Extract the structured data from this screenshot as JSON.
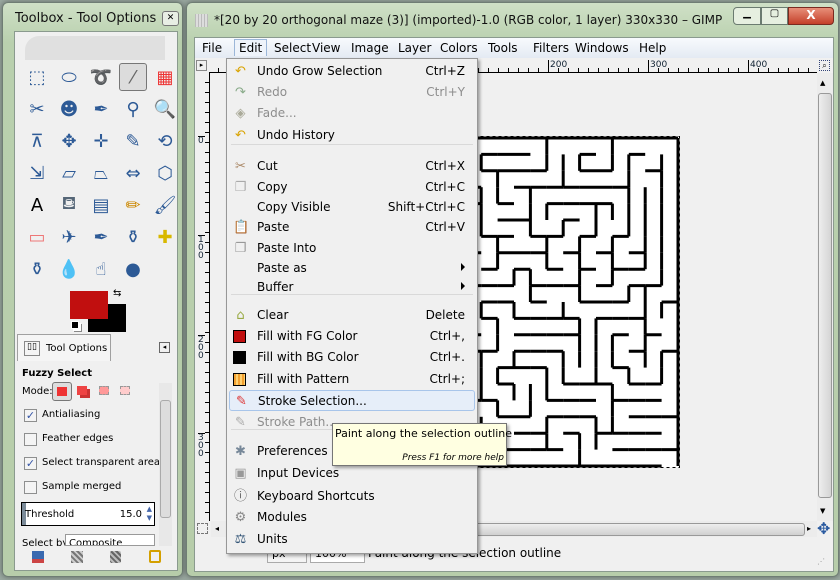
{
  "toolbox": {
    "title": "Toolbox - Tool Options",
    "tools": [
      "rect-select",
      "ellipse-select",
      "free-select",
      "fuzzy-select",
      "select-by-color",
      "scissors-select",
      "foreground-select",
      "paths",
      "color-picker",
      "zoom",
      "measure",
      "move",
      "align",
      "crop",
      "rotate",
      "scale",
      "shear",
      "perspective",
      "flip",
      "cage-transform",
      "text",
      "bucket-fill",
      "blend",
      "pencil",
      "paintbrush",
      "eraser",
      "airbrush",
      "ink",
      "clone",
      "heal",
      "perspective-clone",
      "blur-sharpen",
      "smudge",
      "dodge-burn"
    ],
    "active_tool": "fuzzy-select",
    "fg_color": "#c10f0f",
    "bg_color": "#000000"
  },
  "tool_options": {
    "tab_label": "Tool Options",
    "title": "Fuzzy Select",
    "mode_label": "Mode:",
    "options": [
      {
        "label": "Antialiasing",
        "checked": true
      },
      {
        "label": "Feather edges",
        "checked": false
      },
      {
        "label": "Select transparent areas",
        "checked": true
      },
      {
        "label": "Sample merged",
        "checked": false
      }
    ],
    "threshold_label": "Threshold",
    "threshold_value": "15.0",
    "select_by_label": "Select by:",
    "select_by_value": "Composite"
  },
  "image_window": {
    "title": "*[20 by 20 orthogonal maze (3)] (imported)-1.0 (RGB color, 1 layer) 330x330 – GIMP",
    "menubar": [
      "File",
      "Edit",
      "Select",
      "View",
      "Image",
      "Layer",
      "Colors",
      "Tools",
      "Filters",
      "Windows",
      "Help"
    ],
    "active_menu": "Edit",
    "hruler": [
      "200",
      "300",
      "400"
    ],
    "vruler": [
      "0",
      "100",
      "200",
      "300"
    ],
    "status": {
      "unit": "px",
      "zoom": "100%",
      "message": "Paint along the selection outline"
    }
  },
  "edit_menu": [
    {
      "label": "Undo Grow Selection",
      "shortcut": "Ctrl+Z",
      "icon": "undo-icon"
    },
    {
      "label": "Redo",
      "shortcut": "Ctrl+Y",
      "icon": "redo-icon",
      "disabled": true
    },
    {
      "label": "Fade...",
      "icon": "fade-icon",
      "disabled": true
    },
    {
      "label": "Undo History",
      "icon": "undo-history-icon"
    },
    {
      "sep": true
    },
    {
      "label": "Cut",
      "shortcut": "Ctrl+X",
      "icon": "cut-icon"
    },
    {
      "label": "Copy",
      "shortcut": "Ctrl+C",
      "icon": "copy-icon"
    },
    {
      "label": "Copy Visible",
      "shortcut": "Shift+Ctrl+C"
    },
    {
      "label": "Paste",
      "shortcut": "Ctrl+V",
      "icon": "paste-icon"
    },
    {
      "label": "Paste Into",
      "icon": "paste-into-icon"
    },
    {
      "label": "Paste as",
      "submenu": true
    },
    {
      "label": "Buffer",
      "submenu": true
    },
    {
      "sep": true
    },
    {
      "label": "Clear",
      "shortcut": "Delete",
      "icon": "clear-icon"
    },
    {
      "label": "Fill with FG Color",
      "shortcut": "Ctrl+,",
      "icon": "fill-fg-icon"
    },
    {
      "label": "Fill with BG Color",
      "shortcut": "Ctrl+.",
      "icon": "fill-bg-icon"
    },
    {
      "label": "Fill with Pattern",
      "shortcut": "Ctrl+;",
      "icon": "fill-pattern-icon"
    },
    {
      "label": "Stroke Selection...",
      "icon": "stroke-selection-icon",
      "highlighted": true
    },
    {
      "label": "Stroke Path...",
      "icon": "stroke-path-icon",
      "disabled": true
    },
    {
      "sep": true
    },
    {
      "label": "Preferences",
      "icon": "preferences-icon"
    },
    {
      "label": "Input Devices",
      "icon": "input-devices-icon"
    },
    {
      "label": "Keyboard Shortcuts",
      "icon": "keyboard-shortcuts-icon"
    },
    {
      "label": "Modules",
      "icon": "modules-icon"
    },
    {
      "label": "Units",
      "icon": "units-icon"
    }
  ],
  "tooltip": {
    "text": "Paint along the selection outline",
    "hint": "Press F1 for more help"
  }
}
